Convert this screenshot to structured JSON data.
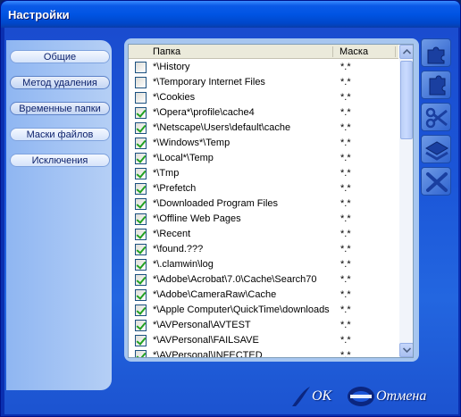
{
  "window": {
    "title": "Настройки"
  },
  "nav": {
    "items": [
      {
        "label": "Общие"
      },
      {
        "label": "Метод удаления"
      },
      {
        "label": "Временные папки"
      },
      {
        "label": "Маски файлов"
      },
      {
        "label": "Исключения"
      }
    ]
  },
  "list": {
    "columns": {
      "folder": "Папка",
      "mask": "Маска"
    },
    "rows": [
      {
        "path": "*\\History",
        "mask": "*.*",
        "checked": false
      },
      {
        "path": "*\\Temporary Internet Files",
        "mask": "*.*",
        "checked": false
      },
      {
        "path": "*\\Cookies",
        "mask": "*.*",
        "checked": false
      },
      {
        "path": "*\\Opera*\\profile\\cache4",
        "mask": "*.*",
        "checked": true
      },
      {
        "path": "*\\Netscape\\Users\\default\\cache",
        "mask": "*.*",
        "checked": true
      },
      {
        "path": "*\\Windows*\\Temp",
        "mask": "*.*",
        "checked": true
      },
      {
        "path": "*\\Local*\\Temp",
        "mask": "*.*",
        "checked": true
      },
      {
        "path": "*\\Tmp",
        "mask": "*.*",
        "checked": true
      },
      {
        "path": "*\\Prefetch",
        "mask": "*.*",
        "checked": true
      },
      {
        "path": "*\\Downloaded Program Files",
        "mask": "*.*",
        "checked": true
      },
      {
        "path": "*\\Offline Web Pages",
        "mask": "*.*",
        "checked": true
      },
      {
        "path": "*\\Recent",
        "mask": "*.*",
        "checked": true
      },
      {
        "path": "*\\found.???",
        "mask": "*.*",
        "checked": true
      },
      {
        "path": "*\\.clamwin\\log",
        "mask": "*.*",
        "checked": true
      },
      {
        "path": "*\\Adobe\\Acrobat\\7.0\\Cache\\Search70",
        "mask": "*.*",
        "checked": true
      },
      {
        "path": "*\\Adobe\\CameraRaw\\Cache",
        "mask": "*.*",
        "checked": true
      },
      {
        "path": "*\\Apple Computer\\QuickTime\\downloads",
        "mask": "*.*",
        "checked": true
      },
      {
        "path": "*\\AVPersonal\\AVTEST",
        "mask": "*.*",
        "checked": true
      },
      {
        "path": "*\\AVPersonal\\FAILSAVE",
        "mask": "*.*",
        "checked": true
      },
      {
        "path": "*\\AVPersonal\\INFECTED",
        "mask": "*.*",
        "checked": true
      }
    ]
  },
  "tools": [
    {
      "icon": "puzzle-add-icon"
    },
    {
      "icon": "puzzle-edit-icon"
    },
    {
      "icon": "scissors-icon"
    },
    {
      "icon": "layers-icon"
    },
    {
      "icon": "cross-icon"
    }
  ],
  "footer": {
    "ok_label": "OK",
    "cancel_label": "Отмена"
  },
  "colors": {
    "accent": "#0054e3",
    "panel": "#1b56d8",
    "check": "#21a121"
  }
}
